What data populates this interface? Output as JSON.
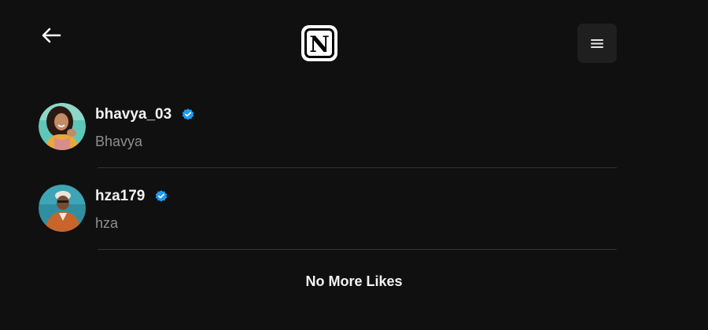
{
  "header": {
    "back_icon": "arrow-left-icon",
    "logo_letter": "N",
    "menu_icon": "hamburger-menu-icon"
  },
  "likes": [
    {
      "username": "bhavya_03",
      "display_name": "Bhavya",
      "verified": true,
      "avatar": "avatar-photo-woman"
    },
    {
      "username": "hza179",
      "display_name": "hza",
      "verified": true,
      "avatar": "avatar-photo-man"
    }
  ],
  "end_message": "No More Likes",
  "colors": {
    "background": "#101010",
    "verified_badge": "#1d9bf0",
    "divider": "#333333",
    "secondary_text": "#8e8e8e",
    "menu_button_bg": "#1f1f1f"
  }
}
